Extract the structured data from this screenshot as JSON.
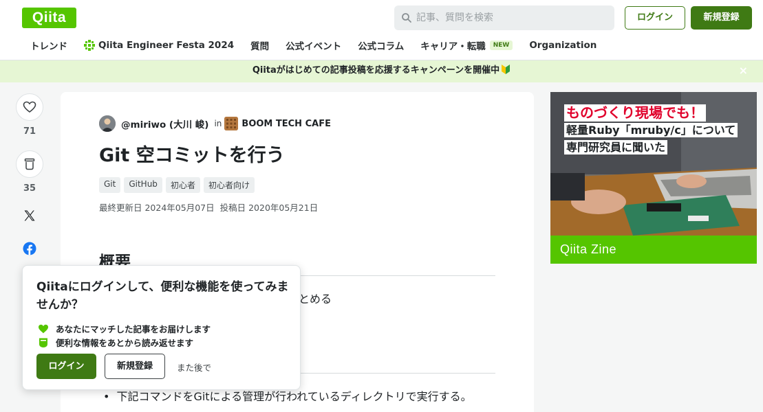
{
  "header": {
    "logo": "Qiita",
    "search_placeholder": "記事、質問を検索",
    "login_label": "ログイン",
    "signup_label": "新規登録"
  },
  "nav": {
    "items": [
      {
        "label": "トレンド"
      },
      {
        "label": "Qiita Engineer Festa 2024",
        "icon": "festa-icon"
      },
      {
        "label": "質問"
      },
      {
        "label": "公式イベント"
      },
      {
        "label": "公式コラム"
      },
      {
        "label": "キャリア・転職",
        "badge": "NEW"
      },
      {
        "label": "Organization"
      }
    ]
  },
  "banner": {
    "text": "Qiitaがはじめての記事投稿を応援するキャンペーンを開催中",
    "close": "×"
  },
  "actions": {
    "like_count": "71",
    "stock_count": "35",
    "icons": [
      "heart-icon",
      "stock-icon",
      "x-icon",
      "facebook-icon"
    ]
  },
  "article": {
    "author": "@miriwo (大川 峻)",
    "in_label": "in",
    "organization": "BOOM TECH CAFE",
    "title": "Git 空コミットを行う",
    "tags": [
      "Git",
      "GitHub",
      "初心者",
      "初心者向け"
    ],
    "updated": "最終更新日 2024年05月07日",
    "posted": "投稿日 2020年05月21日",
    "section_heading": "概要",
    "partial_text": "とめる",
    "bullet_text": "下記コマンドをGitによる管理が行われているディレクトリで実行する。"
  },
  "ad": {
    "headline1": "ものづくり現場でも！",
    "headline2": "軽量Ruby「mruby/c」について",
    "headline3": "専門研究員に聞いた",
    "brand": "Qiita Zine"
  },
  "popup": {
    "title": "Qiitaにログインして、便利な機能を使ってみませんか？",
    "benefits": [
      "あなたにマッチした記事をお届けします",
      "便利な情報をあとから読み返せます"
    ],
    "login_label": "ログイン",
    "signup_label": "新規登録",
    "later_label": "また後で"
  },
  "colors": {
    "brand_green": "#55c500",
    "dark_green": "#3f7a14",
    "banner_bg": "#e6f6d4"
  }
}
